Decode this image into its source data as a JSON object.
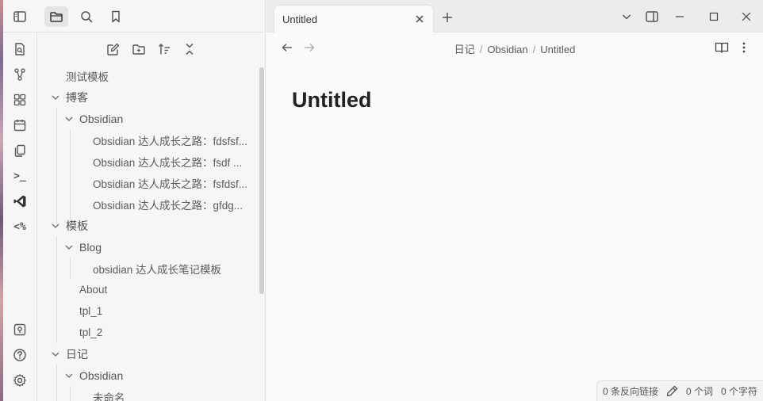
{
  "top_left": {
    "icons": [
      "sidebar-toggle-icon",
      "folder-icon",
      "search-icon",
      "bookmark-icon"
    ]
  },
  "ribbon": {
    "icons": [
      "open-quick-switcher-icon",
      "graph-view-icon",
      "canvas-icon",
      "calendar-icon",
      "templates-icon",
      "command-palette-icon",
      "vscode-icon",
      "templater-icon",
      "vault-switcher-icon",
      "help-icon",
      "settings-icon"
    ],
    "terminal_glyph": ">_",
    "templater_glyph": "<%"
  },
  "file_explorer": {
    "tools": [
      "new-note-icon",
      "new-folder-icon",
      "sort-icon",
      "collapse-all-icon"
    ],
    "tree": [
      {
        "label": "测试模板"
      },
      {
        "label": "搏客"
      },
      {
        "label": "Obsidian"
      },
      {
        "label": "Obsidian 达人成长之路：fdsfsf..."
      },
      {
        "label": "Obsidian 达人成长之路：fsdf ..."
      },
      {
        "label": "Obsidian 达人成长之路：fsfdsf..."
      },
      {
        "label": "Obsidian 达人成长之路：gfdg..."
      },
      {
        "label": "模板"
      },
      {
        "label": "Blog"
      },
      {
        "label": "obsidian 达人成长笔记模板"
      },
      {
        "label": "About"
      },
      {
        "label": "tpl_1"
      },
      {
        "label": "tpl_2"
      },
      {
        "label": "日记"
      },
      {
        "label": "Obsidian"
      },
      {
        "label": "未命名"
      }
    ]
  },
  "tabs": {
    "active": {
      "title": "Untitled"
    }
  },
  "editor": {
    "breadcrumb": [
      "日记",
      "Obsidian",
      "Untitled"
    ],
    "breadcrumb_sep": "/",
    "title": "Untitled"
  },
  "status_bar": {
    "backlinks": "0 条反向链接",
    "words": "0 个词",
    "chars": "0 个字符"
  }
}
